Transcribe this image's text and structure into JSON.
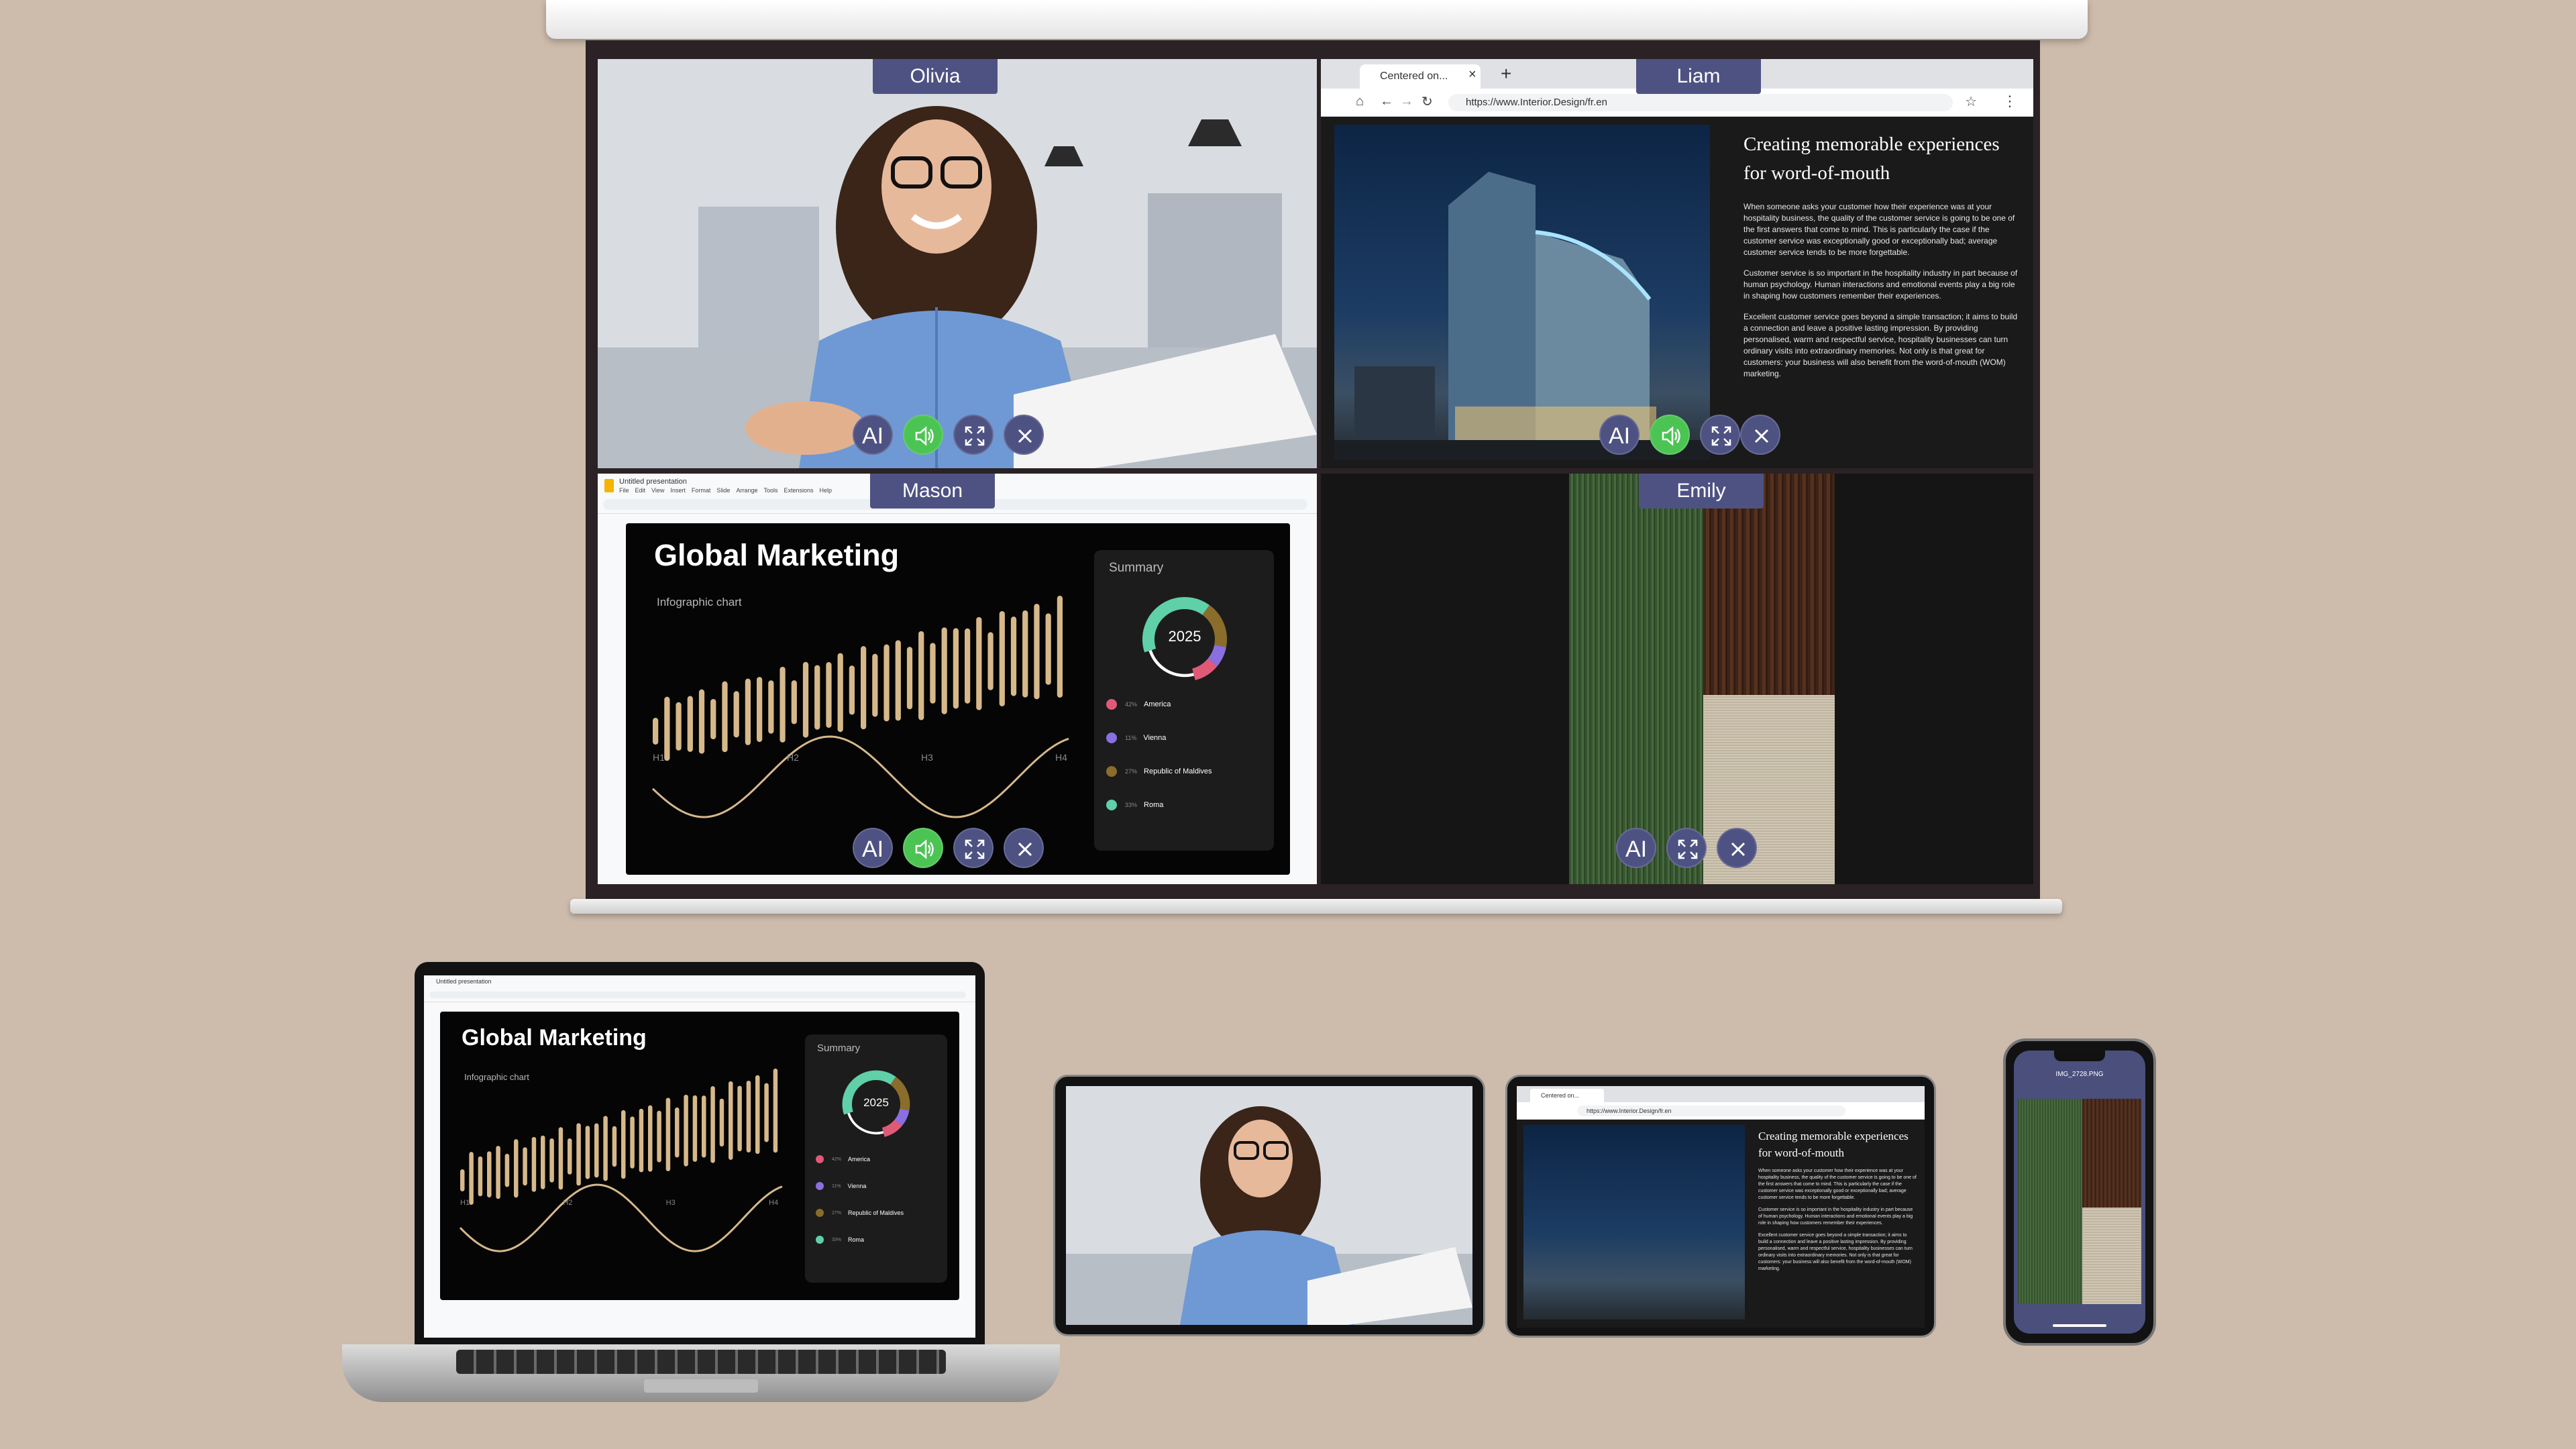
{
  "participants": {
    "olivia": {
      "name": "Olivia"
    },
    "liam": {
      "name": "Liam"
    },
    "mason": {
      "name": "Mason"
    },
    "emily": {
      "name": "Emily"
    }
  },
  "controls": {
    "ai_label": "AI"
  },
  "browser": {
    "tab_title": "Centered on...",
    "new_tab": "+",
    "close_tab": "×",
    "url": "https://www.Interior.Design/fr.en"
  },
  "article": {
    "title": "Creating memorable experiences for word-of-mouth",
    "p1": "When someone asks your customer how their experience was at your hospitality business, the quality of the customer service is going to be one of the first answers that come to mind. This is particularly the case if the customer service was exceptionally good or exceptionally bad; average customer service tends to be more forgettable.",
    "p2": "Customer service is so important in the hospitality industry in part because of human psychology. Human interactions and emotional events play a big role in shaping how customers remember their experiences.",
    "p3": "Excellent customer service goes beyond a simple transaction; it aims to build a connection and leave a positive lasting impression. By providing personalised, warm and respectful service, hospitality businesses can turn ordinary visits into extraordinary memories. Not only is that great for customers: your business will also benefit from the word-of-mouth (WOM) marketing."
  },
  "slides_app": {
    "doc_title": "Untitled presentation",
    "menu": [
      "File",
      "Edit",
      "View",
      "Insert",
      "Format",
      "Slide",
      "Arrange",
      "Tools",
      "Extensions",
      "Help"
    ]
  },
  "slide": {
    "title": "Global Marketing",
    "subtitle": "Infographic chart",
    "summary_title": "Summary",
    "donut_year": "2025",
    "h_labels": [
      "H1",
      "H2",
      "H3",
      "H4"
    ],
    "legend": [
      {
        "pct": "42%",
        "label": "America",
        "color": "#e05a78"
      },
      {
        "pct": "11%",
        "label": "Vienna",
        "color": "#8a6fe0"
      },
      {
        "pct": "27%",
        "label": "Republic of Maldives",
        "color": "#8a6d2a"
      },
      {
        "pct": "33%",
        "label": "Roma",
        "color": "#5fd0a8"
      }
    ]
  },
  "colors": {
    "background": "#cdbbab",
    "name_tag": "#4e5283",
    "speaker_on": "#4cc453",
    "bars": "#d6b88a"
  },
  "phone": {
    "file_name": "IMG_2728.PNG"
  }
}
